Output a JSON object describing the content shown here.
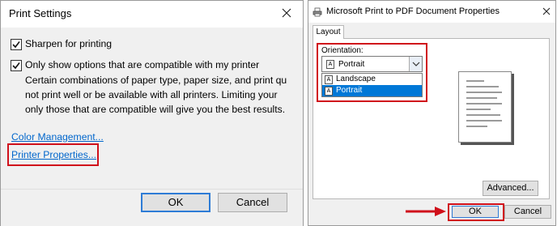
{
  "print_settings": {
    "title": "Print Settings",
    "sharpen_label": "Sharpen for printing",
    "sharpen_checked": true,
    "compatible_label": "Only show options that are compatible with my printer",
    "compatible_checked": true,
    "description_lines": [
      "Certain combinations of paper type, paper size, and print qu",
      "not print well or be available with all printers.  Limiting your",
      "only those that are compatible will give you the best results."
    ],
    "color_management_link": "Color Management...",
    "printer_properties_link": "Printer Properties...",
    "ok_label": "OK",
    "cancel_label": "Cancel"
  },
  "pdf_properties": {
    "title": "Microsoft Print to PDF Document Properties",
    "tab_label": "Layout",
    "orientation_label": "Orientation:",
    "orientation_value": "Portrait",
    "orientation_options": [
      "Landscape",
      "Portrait"
    ],
    "selected_option": "Portrait",
    "advanced_label": "Advanced...",
    "ok_label": "OK",
    "cancel_label": "Cancel"
  },
  "colors": {
    "highlight": "#d0101b",
    "selection": "#0078d7",
    "link": "#0066cc"
  }
}
